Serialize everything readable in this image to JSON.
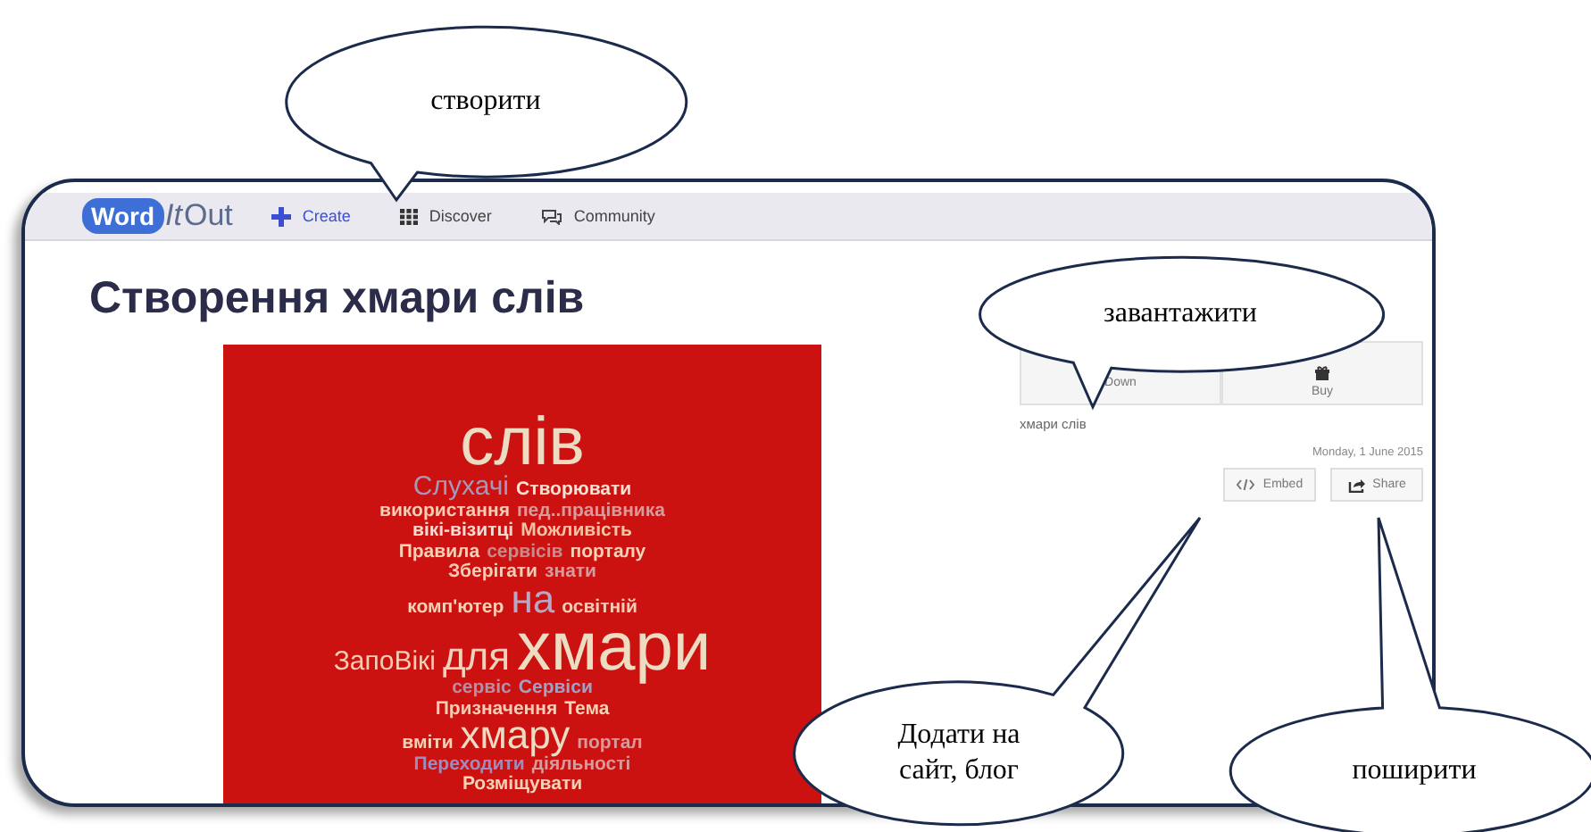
{
  "nav": {
    "logo": "Word",
    "logo_italic": "It",
    "logo_rest": "Out",
    "items": [
      {
        "label": "Create",
        "selected": true
      },
      {
        "label": "Discover",
        "selected": false
      },
      {
        "label": "Community",
        "selected": false
      }
    ]
  },
  "title": "Створення хмари слів",
  "cloud": {
    "rows": [
      {
        "words": [
          {
            "text": "слів",
            "kind": "xl",
            "color": "#ecdcc2"
          }
        ]
      },
      {
        "words": [
          {
            "text": "Слухачі",
            "kind": "m",
            "color": "#a49ab8"
          },
          {
            "text": "Створювати",
            "kind": "s",
            "color": "#f6e2d2"
          }
        ]
      },
      {
        "words": [
          {
            "text": "використання",
            "kind": "s",
            "color": "#f6cdb4"
          },
          {
            "text": "пед..працівника",
            "kind": "s",
            "color": "#d89a9a"
          }
        ]
      },
      {
        "words": [
          {
            "text": "вікі-візитці",
            "kind": "s",
            "color": "#f6dcd2"
          },
          {
            "text": "Можливість",
            "kind": "s",
            "color": "#f6c4a4"
          }
        ]
      },
      {
        "words": [
          {
            "text": "Правила",
            "kind": "s",
            "color": "#f8d2b4"
          },
          {
            "text": "сервісів",
            "kind": "s",
            "color": "#c88a8a"
          },
          {
            "text": "порталу",
            "kind": "s",
            "color": "#f8d2b4"
          }
        ]
      },
      {
        "words": [
          {
            "text": "Зберігати",
            "kind": "s",
            "color": "#f6cdb4"
          },
          {
            "text": "знати",
            "kind": "s",
            "color": "#d89a9a"
          }
        ]
      },
      {
        "words": [
          {
            "text": "комп'ютер",
            "kind": "s",
            "color": "#f8d2b4"
          },
          {
            "text": "на",
            "kind": "l",
            "color": "#b8a8c4"
          },
          {
            "text": "освітній",
            "kind": "s",
            "color": "#f6cdb4"
          }
        ]
      },
      {
        "words": [
          {
            "text": "ЗапоВікі",
            "kind": "m",
            "color": "#f6cdb4"
          },
          {
            "text": "для",
            "kind": "l",
            "color": "#ecd4bc"
          },
          {
            "text": "хмари",
            "kind": "xl",
            "color": "#ecdcc2"
          }
        ]
      },
      {
        "words": [
          {
            "text": "сервіс",
            "kind": "s",
            "color": "#b88ea4"
          },
          {
            "text": "Сервіси",
            "kind": "s",
            "color": "#a4a0c4"
          }
        ]
      },
      {
        "words": [
          {
            "text": "Призначення",
            "kind": "s",
            "color": "#f6cdb4"
          },
          {
            "text": "Тема",
            "kind": "s",
            "color": "#f8d2b4"
          }
        ]
      },
      {
        "words": [
          {
            "text": "вміти",
            "kind": "s",
            "color": "#f8d2b4"
          },
          {
            "text": "хмару",
            "kind": "l",
            "color": "#ecdcc2"
          },
          {
            "text": "портал",
            "kind": "s",
            "color": "#d89a9a"
          }
        ]
      },
      {
        "words": [
          {
            "text": "Переходити",
            "kind": "s",
            "color": "#a08cbc"
          },
          {
            "text": "діяльності",
            "kind": "s",
            "color": "#d89a9a"
          }
        ]
      },
      {
        "words": [
          {
            "text": "Розміщувати",
            "kind": "s",
            "color": "#f8d2b4"
          }
        ]
      }
    ]
  },
  "actions": [
    {
      "label": "Down"
    },
    {
      "label": "Buy"
    }
  ],
  "cloud_name": "хмари слів",
  "date": "Monday, 1 June 2015",
  "share_buttons": [
    {
      "label": "Embed"
    },
    {
      "label": "Share"
    }
  ],
  "callouts": [
    {
      "text": "створити"
    },
    {
      "text": "завантажити"
    },
    {
      "text": "Додати на сайт, блог"
    },
    {
      "text": "поширити"
    }
  ]
}
